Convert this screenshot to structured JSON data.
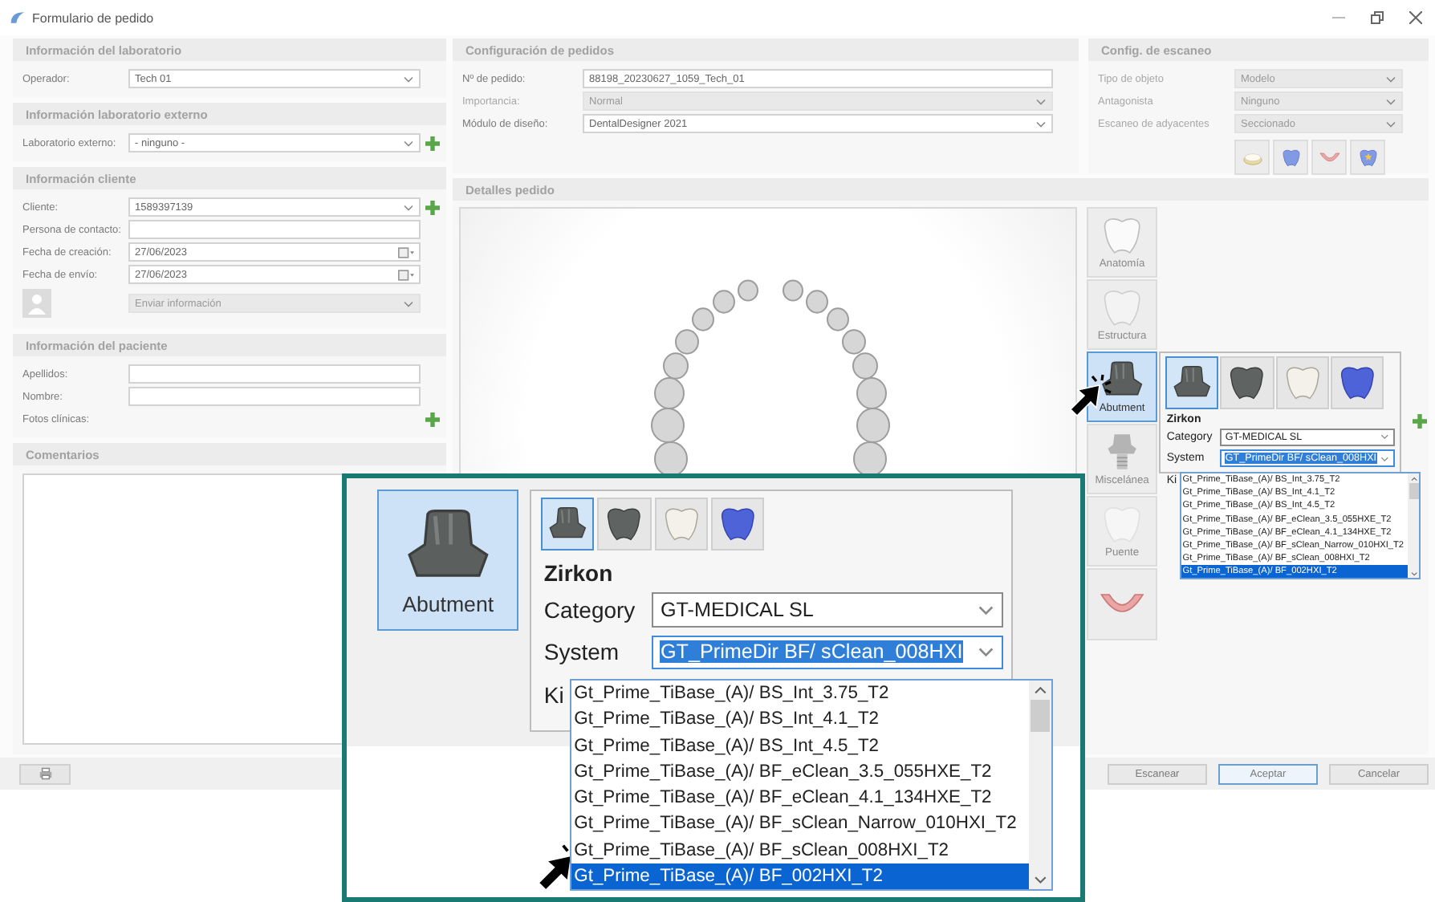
{
  "window": {
    "title": "Formulario de pedido"
  },
  "lab_sections": [
    {
      "title": "Información del laboratorio",
      "fields": [
        {
          "kind": "dropdown",
          "label": "Operador:",
          "value": "Tech 01",
          "disabled": false,
          "add_button": false
        }
      ]
    },
    {
      "title": "Información laboratorio externo",
      "fields": [
        {
          "kind": "dropdown",
          "label": "Laboratorio externo:",
          "value": "- ninguno -",
          "disabled": false,
          "add_button": true
        }
      ]
    },
    {
      "title": "Información cliente",
      "fields": [
        {
          "kind": "dropdown",
          "label": "Cliente:",
          "value": "1589397139",
          "disabled": false,
          "add_button": true
        },
        {
          "kind": "text",
          "label": "Persona de contacto:",
          "disabled": false,
          "add_button": false
        },
        {
          "kind": "date",
          "label": "Fecha de creación:",
          "value": "27/06/2023",
          "disabled": false,
          "add_button": false
        },
        {
          "kind": "date",
          "label": "Fecha de envío:",
          "value": "27/06/2023",
          "disabled": false,
          "add_button": false
        },
        {
          "kind": "send",
          "value": "Enviar información",
          "disabled": true,
          "add_button": false
        }
      ]
    },
    {
      "title": "Información del paciente",
      "fields": [
        {
          "kind": "text",
          "label": "Apellidos:",
          "disabled": false,
          "add_button": false
        },
        {
          "kind": "text",
          "label": "Nombre:",
          "disabled": false,
          "add_button": false
        },
        {
          "kind": "action",
          "label": "Fotos clínicas:",
          "disabled": false,
          "add_button": true
        }
      ]
    },
    {
      "title": "Comentarios",
      "fields": [
        {
          "kind": "textarea",
          "disabled": false,
          "add_button": false
        }
      ]
    }
  ],
  "order_config": {
    "title": "Configuración de pedidos",
    "fields": [
      {
        "kind": "text",
        "label": "Nº de pedido:",
        "value": "88198_20230627_1059_Tech_01",
        "disabled": false,
        "add_button": false
      },
      {
        "kind": "dropdown",
        "label": "Importancia:",
        "value": "Normal",
        "disabled": true,
        "add_button": false
      },
      {
        "kind": "dropdown",
        "label": "Módulo de diseño:",
        "value": "DentalDesigner 2021",
        "disabled": false,
        "add_button": false
      }
    ]
  },
  "scan_config": {
    "title": "Config. de escaneo",
    "fields": [
      {
        "kind": "dropdown",
        "label": "Tipo de objeto",
        "value": "Modelo",
        "disabled": true,
        "add_button": false
      },
      {
        "kind": "dropdown",
        "label": "Antagonista",
        "value": "Ninguno",
        "disabled": true,
        "add_button": false
      },
      {
        "kind": "dropdown",
        "label": "Escaneo de adyacentes",
        "value": "Seccionado",
        "disabled": true,
        "add_button": false
      }
    ],
    "scan_icons": [
      {
        "kind": "model"
      },
      {
        "kind": "tooth"
      },
      {
        "kind": "gums"
      },
      {
        "kind": "tooth-star"
      }
    ]
  },
  "order_details": {
    "title": "Detalles pedido",
    "tools": [
      {
        "kind": "anatomy",
        "label": "Anatomía",
        "selected": false
      },
      {
        "kind": "structure",
        "label": "Estructura",
        "selected": false
      },
      {
        "kind": "abutment",
        "label": "Abutment",
        "selected": true
      },
      {
        "kind": "misc",
        "label": "Miscelánea",
        "selected": false
      },
      {
        "kind": "bridge",
        "label": "Puente",
        "selected": false
      },
      {
        "kind": "gingiva",
        "selected": false
      }
    ],
    "abutment_panel": {
      "material_options": [
        {
          "kind": "abutment",
          "selected": true
        },
        {
          "kind": "crown-dark",
          "selected": false
        },
        {
          "kind": "crown-white",
          "selected": false
        },
        {
          "kind": "cap-blue",
          "selected": false
        }
      ],
      "material": "Zirkon",
      "category": {
        "label": "Category",
        "value": "GT-MEDICAL SL",
        "focused": false
      },
      "system": {
        "label": "System",
        "value": "GT_PrimeDir BF/ sClean_008HXI",
        "focused": true
      },
      "kit_label": "Ki",
      "options": [
        {
          "label": "Gt_Prime_TiBase_(A)/ BS_Int_3.75_T2",
          "selected": false
        },
        {
          "label": "Gt_Prime_TiBase_(A)/ BS_Int_4.1_T2",
          "selected": false
        },
        {
          "label": "Gt_Prime_TiBase_(A)/ BS_Int_4.5_T2",
          "selected": false
        },
        {
          "label": "Gt_Prime_TiBase_(A)/ BF_eClean_3.5_055HXE_T2",
          "selected": false
        },
        {
          "label": "Gt_Prime_TiBase_(A)/ BF_eClean_4.1_134HXE_T2",
          "selected": false
        },
        {
          "label": "Gt_Prime_TiBase_(A)/ BF_sClean_Narrow_010HXI_T2",
          "selected": false
        },
        {
          "label": "Gt_Prime_TiBase_(A)/ BF_sClean_008HXI_T2",
          "selected": false
        },
        {
          "label": "Gt_Prime_TiBase_(A)/ BF_002HXI_T2",
          "selected": true
        }
      ]
    }
  },
  "callout": {
    "tool": {
      "kind": "abutment",
      "label": "Abutment",
      "selected": true
    },
    "panel": {
      "material_options": [
        {
          "kind": "abutment",
          "selected": true
        },
        {
          "kind": "crown-dark",
          "selected": false
        },
        {
          "kind": "crown-white",
          "selected": false
        },
        {
          "kind": "cap-blue",
          "selected": false
        }
      ],
      "material": "Zirkon",
      "category": {
        "label": "Category",
        "value": "GT-MEDICAL SL",
        "focused": false
      },
      "system": {
        "label": "System",
        "value": "GT_PrimeDir BF/ sClean_008HXI",
        "focused": true
      },
      "kit_label": "Ki",
      "options": [
        {
          "label": "Gt_Prime_TiBase_(A)/ BS_Int_3.75_T2",
          "selected": false
        },
        {
          "label": "Gt_Prime_TiBase_(A)/ BS_Int_4.1_T2",
          "selected": false
        },
        {
          "label": "Gt_Prime_TiBase_(A)/ BS_Int_4.5_T2",
          "selected": false
        },
        {
          "label": "Gt_Prime_TiBase_(A)/ BF_eClean_3.5_055HXE_T2",
          "selected": false
        },
        {
          "label": "Gt_Prime_TiBase_(A)/ BF_eClean_4.1_134HXE_T2",
          "selected": false
        },
        {
          "label": "Gt_Prime_TiBase_(A)/ BF_sClean_Narrow_010HXI_T2",
          "selected": false
        },
        {
          "label": "Gt_Prime_TiBase_(A)/ BF_sClean_008HXI_T2",
          "selected": false
        },
        {
          "label": "Gt_Prime_TiBase_(A)/ BF_002HXI_T2",
          "selected": true
        }
      ]
    }
  },
  "footer": {
    "buttons": [
      {
        "label": "Escanear",
        "focused": false
      },
      {
        "label": "Aceptar",
        "focused": true
      },
      {
        "label": "Cancelar",
        "focused": false
      }
    ]
  }
}
